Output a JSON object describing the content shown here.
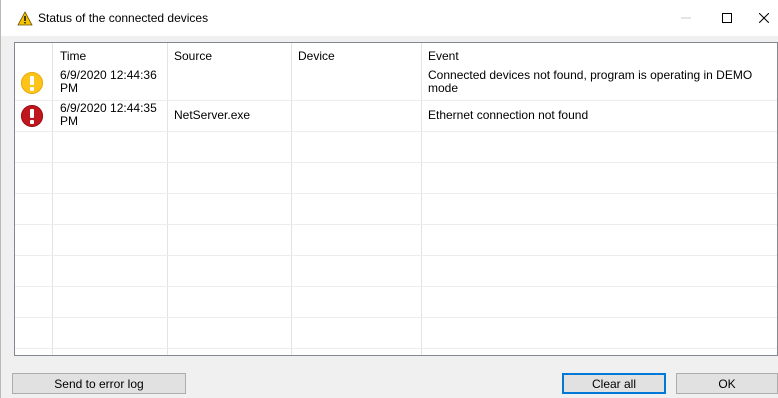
{
  "window": {
    "title": "Status of the connected devices",
    "title_icon": "warning-triangle-icon"
  },
  "table": {
    "columns": [
      "Time",
      "Source",
      "Device",
      "Event"
    ],
    "rows": [
      {
        "level": "warning",
        "icon": "warning-circle-icon",
        "time_line1": "6/9/2020 12:44:36",
        "time_line2": "PM",
        "source": "",
        "device": "",
        "event_line1": "Connected devices not found, program is operating in DEMO",
        "event_line2": "mode"
      },
      {
        "level": "error",
        "icon": "error-circle-icon",
        "time_line1": "6/9/2020 12:44:35",
        "time_line2": "PM",
        "source": "NetServer.exe",
        "device": "",
        "event_line1": "Ethernet connection not found",
        "event_line2": ""
      }
    ]
  },
  "buttons": {
    "send_log": "Send to error log",
    "clear_all": "Clear all",
    "ok": "OK"
  },
  "colors": {
    "warning": "#fcc419",
    "error": "#c0161d",
    "focus": "#0078d7"
  }
}
